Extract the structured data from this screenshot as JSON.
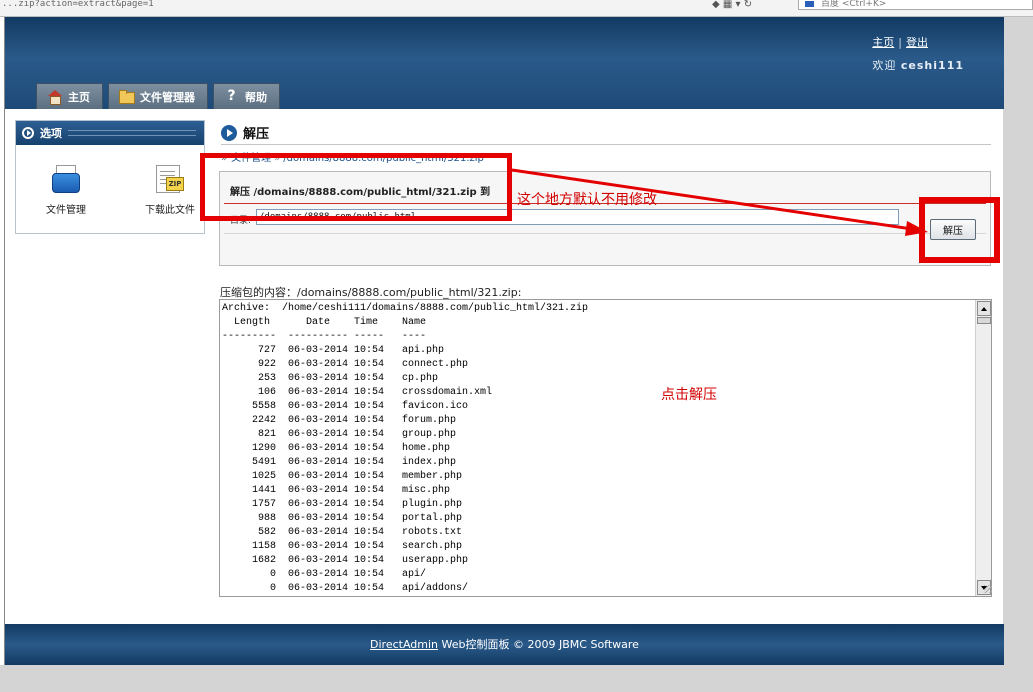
{
  "browser": {
    "url": "...zip?action=extract&page=1",
    "search_placeholder": "百度 <Ctrl+K>"
  },
  "header": {
    "home_link": "主页",
    "logout_link": "登出",
    "welcome_prefix": "欢迎",
    "username": "ceshi111",
    "tabs": [
      {
        "label": "主页",
        "icon": "home-icon"
      },
      {
        "label": "文件管理器",
        "icon": "folder-icon"
      },
      {
        "label": "帮助",
        "icon": "help-icon"
      }
    ]
  },
  "sidebar": {
    "title": "选项",
    "items": [
      {
        "label": "文件管理",
        "icon": "file-box-icon"
      },
      {
        "label": "下载此文件",
        "icon": "zip-file-icon"
      }
    ]
  },
  "main": {
    "title": "解压",
    "breadcrumb": {
      "root": "文件管理",
      "path": "/domains/8888.com/public_html/321.zip"
    },
    "form": {
      "legend": "解压 /domains/8888.com/public_html/321.zip 到",
      "dir_label": "目录:",
      "dir_value": "/domains/8888.com/public_html",
      "submit_label": "解压"
    },
    "contents_label": "压缩包的内容：/domains/8888.com/public_html/321.zip:",
    "listing": {
      "archive_line": "Archive:  /home/ceshi111/domains/8888.com/public_html/321.zip",
      "columns": [
        "Length",
        "Date",
        "Time",
        "Name"
      ],
      "separators": [
        "---------",
        "----------",
        "-----",
        "----"
      ],
      "rows": [
        {
          "length": "727",
          "date": "06-03-2014",
          "time": "10:54",
          "name": "api.php"
        },
        {
          "length": "922",
          "date": "06-03-2014",
          "time": "10:54",
          "name": "connect.php"
        },
        {
          "length": "253",
          "date": "06-03-2014",
          "time": "10:54",
          "name": "cp.php"
        },
        {
          "length": "106",
          "date": "06-03-2014",
          "time": "10:54",
          "name": "crossdomain.xml"
        },
        {
          "length": "5558",
          "date": "06-03-2014",
          "time": "10:54",
          "name": "favicon.ico"
        },
        {
          "length": "2242",
          "date": "06-03-2014",
          "time": "10:54",
          "name": "forum.php"
        },
        {
          "length": "821",
          "date": "06-03-2014",
          "time": "10:54",
          "name": "group.php"
        },
        {
          "length": "1290",
          "date": "06-03-2014",
          "time": "10:54",
          "name": "home.php"
        },
        {
          "length": "5491",
          "date": "06-03-2014",
          "time": "10:54",
          "name": "index.php"
        },
        {
          "length": "1025",
          "date": "06-03-2014",
          "time": "10:54",
          "name": "member.php"
        },
        {
          "length": "1441",
          "date": "06-03-2014",
          "time": "10:54",
          "name": "misc.php"
        },
        {
          "length": "1757",
          "date": "06-03-2014",
          "time": "10:54",
          "name": "plugin.php"
        },
        {
          "length": "988",
          "date": "06-03-2014",
          "time": "10:54",
          "name": "portal.php"
        },
        {
          "length": "582",
          "date": "06-03-2014",
          "time": "10:54",
          "name": "robots.txt"
        },
        {
          "length": "1158",
          "date": "06-03-2014",
          "time": "10:54",
          "name": "search.php"
        },
        {
          "length": "1682",
          "date": "06-03-2014",
          "time": "10:54",
          "name": "userapp.php"
        },
        {
          "length": "0",
          "date": "06-03-2014",
          "time": "10:54",
          "name": "api/"
        },
        {
          "length": "0",
          "date": "06-03-2014",
          "time": "10:54",
          "name": "api/addons/"
        }
      ]
    }
  },
  "annotations": {
    "note_dir": "这个地方默认不用修改",
    "note_click": "点击解压",
    "color": "#e50000"
  },
  "footer": {
    "link": "DirectAdmin",
    "text": "Web控制面板 © 2009 JBMC Software"
  }
}
